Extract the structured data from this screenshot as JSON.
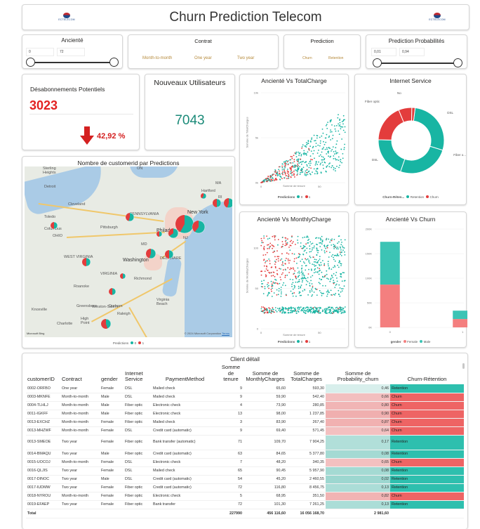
{
  "header": {
    "title": "Churn Prediction Telecom",
    "logo_text": "ECTELECOM"
  },
  "filters": {
    "anciente": {
      "title": "Ancienté",
      "min": "0",
      "max": "72"
    },
    "contrat": {
      "title": "Contrat",
      "options": [
        "Month-to-month",
        "One year",
        "Two year"
      ]
    },
    "prediction": {
      "title": "Prediction",
      "options": [
        "Churn",
        "Retention"
      ]
    },
    "probabilites": {
      "title": "Prediction Probabilités",
      "min": "0,01",
      "max": "0,94"
    }
  },
  "kpi": {
    "desabonnements": {
      "title": "Désabonnements Potentiels",
      "value": "3023",
      "pct": "42,92 %",
      "pct_ratio": 0.4292
    },
    "nouveaux": {
      "title": "Nouveaux Utilisateurs",
      "value": "7043"
    }
  },
  "map": {
    "title": "Nombre de customerid par Predictions",
    "places": [
      "Sterling Heights",
      "Detroit",
      "Cleveland",
      "Toledo",
      "Columbus",
      "Pittsburgh",
      "PENNSYLVANIA",
      "New York",
      "Philadelphia",
      "NJ",
      "MD",
      "Washington",
      "DELAWARE",
      "WEST VIRGINIA",
      "VIRGINIA",
      "Richmond",
      "Roanoke",
      "Winston-Salem",
      "Raleigh",
      "Knoxville",
      "Charlotte",
      "High Point",
      "Virginia Beach",
      "Hartford",
      "OHIO",
      "ON",
      "MA",
      "RI",
      "Durham",
      "Greensboro"
    ],
    "copyright": "© 2024 Microsoft Corporation",
    "terms": "Terms",
    "attribution": "Microsoft Bing",
    "legend_label": "Predictions",
    "legend_items": [
      "0",
      "1"
    ],
    "colors": {
      "retention": "#18b5a3",
      "churn": "#e33c3c"
    }
  },
  "charts": {
    "tc": {
      "title": "Ancienté Vs TotalCharge",
      "xlabel": "Somme de tenure",
      "ylabel": "Somme de TotalCharges",
      "legend_label": "Predictions",
      "legend_items": [
        "0",
        "1"
      ]
    },
    "mc": {
      "title": "Ancienté Vs MonthlyCharge",
      "xlabel": "Somme de tenure",
      "ylabel": "Somme de MonthlyCharges",
      "legend_label": "Predictions",
      "legend_items": [
        "0",
        "1"
      ]
    },
    "internet": {
      "title": "Internet Service",
      "labels": [
        "Fiber optic",
        "No",
        "DSL",
        "Fiber o...",
        "DSL"
      ],
      "legend_label": "Churn-Réten...",
      "legend_items": [
        "Retention",
        "Churn"
      ]
    },
    "churn": {
      "title": "Ancienté Vs Churn",
      "legend_label": "gender",
      "legend_items": [
        "Female",
        "Male"
      ]
    }
  },
  "chart_data": [
    {
      "type": "scatter",
      "title": "Ancienté Vs TotalCharge",
      "xlabel": "Somme de tenure",
      "ylabel": "Somme de TotalCharges",
      "x_ticks": [
        "0",
        "50"
      ],
      "y_ticks": [
        "10k",
        "5k",
        "0k"
      ],
      "xlim": [
        0,
        72
      ],
      "ylim": [
        0,
        10000
      ],
      "series": [
        {
          "name": "0",
          "color": "#18b5a3"
        },
        {
          "name": "1",
          "color": "#e33c3c"
        }
      ]
    },
    {
      "type": "scatter",
      "title": "Ancienté Vs MonthlyCharge",
      "xlabel": "Somme de tenure",
      "ylabel": "Somme de MonthlyCharges",
      "x_ticks": [
        "0",
        "50"
      ],
      "y_ticks": [
        "100",
        "50",
        "0"
      ],
      "xlim": [
        0,
        72
      ],
      "ylim": [
        0,
        120
      ],
      "series": [
        {
          "name": "0",
          "color": "#18b5a3"
        },
        {
          "name": "1",
          "color": "#e33c3c"
        }
      ]
    },
    {
      "type": "pie",
      "title": "Internet Service",
      "slices": [
        {
          "label": "DSL",
          "group": "Retention",
          "value": 1962,
          "color": "#18b5a3"
        },
        {
          "label": "Fiber optic",
          "group": "Retention",
          "value": 1799,
          "color": "#18b5a3"
        },
        {
          "label": "No",
          "group": "Retention",
          "value": 1413,
          "color": "#18b5a3"
        },
        {
          "label": "DSL",
          "group": "Churn",
          "value": 459,
          "color": "#e33c3c"
        },
        {
          "label": "Fiber optic",
          "group": "Churn",
          "value": 1297,
          "color": "#e33c3c"
        },
        {
          "label": "No",
          "group": "Churn",
          "value": 113,
          "color": "#e33c3c"
        }
      ]
    },
    {
      "type": "bar",
      "title": "Ancienté Vs Churn",
      "categories": [
        "0",
        "1"
      ],
      "y_ticks": [
        "200K",
        "150K",
        "100K",
        "50K",
        "0K"
      ],
      "ylim": [
        0,
        200000
      ],
      "series": [
        {
          "name": "Female",
          "values": [
            87000,
            17000
          ],
          "color": "#f47f7f"
        },
        {
          "name": "Male",
          "values": [
            87000,
            17000
          ],
          "color": "#3cc4b5"
        }
      ]
    }
  ],
  "table": {
    "title": "Client détail",
    "columns": [
      "customerID",
      "Contract",
      "gender",
      "Internet Service",
      "PaymentMethod",
      "Somme de tenure",
      "Somme de MonthlyCharges",
      "Somme de TotalCharges",
      "Somme de Probability_churn",
      "Churn-Rétention"
    ],
    "rows": [
      [
        "0002-ORFBO",
        "One year",
        "Female",
        "DSL",
        "Mailed check",
        "9",
        "65,60",
        "593,30",
        "0,46",
        "Retention"
      ],
      [
        "0003-MKNFE",
        "Month-to-month",
        "Male",
        "DSL",
        "Mailed check",
        "9",
        "59,90",
        "542,40",
        "0,66",
        "Churn"
      ],
      [
        "0004-TLHLJ",
        "Month-to-month",
        "Male",
        "Fiber optic",
        "Electronic check",
        "4",
        "73,90",
        "280,85",
        "0,80",
        "Churn"
      ],
      [
        "0011-IGKFF",
        "Month-to-month",
        "Male",
        "Fiber optic",
        "Electronic check",
        "13",
        "98,00",
        "1 237,85",
        "0,90",
        "Churn"
      ],
      [
        "0013-EXCHZ",
        "Month-to-month",
        "Female",
        "Fiber optic",
        "Mailed check",
        "3",
        "83,90",
        "267,40",
        "0,87",
        "Churn"
      ],
      [
        "0013-MHZWF",
        "Month-to-month",
        "Female",
        "DSL",
        "Credit card (automatic)",
        "9",
        "69,40",
        "571,45",
        "0,64",
        "Churn"
      ],
      [
        "0013-SMEOE",
        "Two year",
        "Female",
        "Fiber optic",
        "Bank transfer (automatic)",
        "71",
        "109,70",
        "7 904,25",
        "0,17",
        "Retention"
      ],
      [
        "0014-BMAQU",
        "Two year",
        "Male",
        "Fiber optic",
        "Credit card (automatic)",
        "63",
        "84,65",
        "5 377,80",
        "0,08",
        "Retention"
      ],
      [
        "0015-UOCOJ",
        "Month-to-month",
        "Female",
        "DSL",
        "Electronic check",
        "7",
        "48,20",
        "340,35",
        "0,65",
        "Churn"
      ],
      [
        "0016-QLJIS",
        "Two year",
        "Female",
        "DSL",
        "Mailed check",
        "65",
        "90,45",
        "5 957,90",
        "0,08",
        "Retention"
      ],
      [
        "0017-DINOC",
        "Two year",
        "Male",
        "DSL",
        "Credit card (automatic)",
        "54",
        "45,20",
        "2 460,55",
        "0,02",
        "Retention"
      ],
      [
        "0017-IUDMW",
        "Two year",
        "Female",
        "Fiber optic",
        "Credit card (automatic)",
        "72",
        "116,80",
        "8 456,75",
        "0,13",
        "Retention"
      ],
      [
        "0018-NYROU",
        "Month-to-month",
        "Female",
        "Fiber optic",
        "Electronic check",
        "5",
        "68,95",
        "351,50",
        "0,82",
        "Churn"
      ],
      [
        "0019-EFAEP",
        "Two year",
        "Female",
        "Fiber optic",
        "Bank transfer",
        "72",
        "101,30",
        "7 261,25",
        "0,13",
        "Retention"
      ]
    ],
    "total": [
      "Total",
      "227990",
      "456 116,60",
      "16 056 168,70",
      "2 981,60"
    ]
  }
}
